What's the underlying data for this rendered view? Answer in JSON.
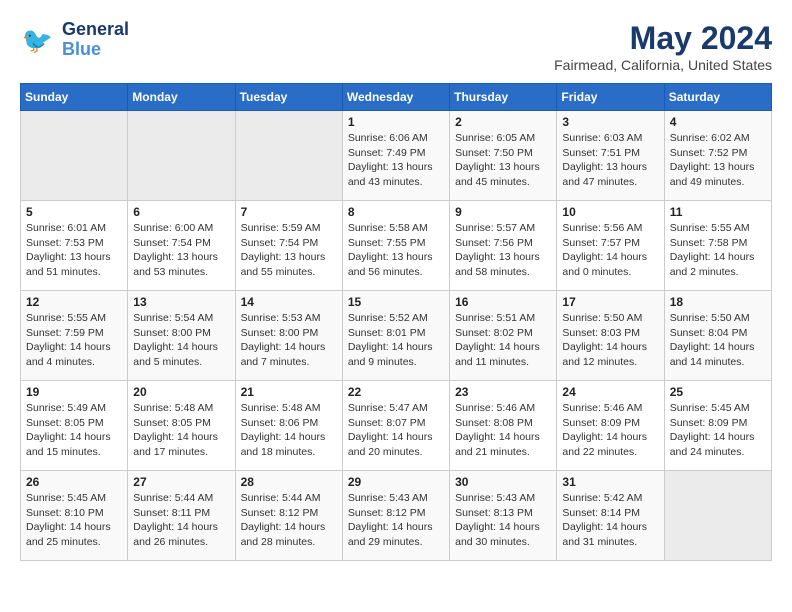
{
  "header": {
    "logo_line1": "General",
    "logo_line2": "Blue",
    "month_year": "May 2024",
    "location": "Fairmead, California, United States"
  },
  "days_of_week": [
    "Sunday",
    "Monday",
    "Tuesday",
    "Wednesday",
    "Thursday",
    "Friday",
    "Saturday"
  ],
  "weeks": [
    [
      {
        "day": "",
        "sunrise": "",
        "sunset": "",
        "daylight": "",
        "empty": true
      },
      {
        "day": "",
        "sunrise": "",
        "sunset": "",
        "daylight": "",
        "empty": true
      },
      {
        "day": "",
        "sunrise": "",
        "sunset": "",
        "daylight": "",
        "empty": true
      },
      {
        "day": "1",
        "sunrise": "Sunrise: 6:06 AM",
        "sunset": "Sunset: 7:49 PM",
        "daylight": "Daylight: 13 hours and 43 minutes."
      },
      {
        "day": "2",
        "sunrise": "Sunrise: 6:05 AM",
        "sunset": "Sunset: 7:50 PM",
        "daylight": "Daylight: 13 hours and 45 minutes."
      },
      {
        "day": "3",
        "sunrise": "Sunrise: 6:03 AM",
        "sunset": "Sunset: 7:51 PM",
        "daylight": "Daylight: 13 hours and 47 minutes."
      },
      {
        "day": "4",
        "sunrise": "Sunrise: 6:02 AM",
        "sunset": "Sunset: 7:52 PM",
        "daylight": "Daylight: 13 hours and 49 minutes."
      }
    ],
    [
      {
        "day": "5",
        "sunrise": "Sunrise: 6:01 AM",
        "sunset": "Sunset: 7:53 PM",
        "daylight": "Daylight: 13 hours and 51 minutes."
      },
      {
        "day": "6",
        "sunrise": "Sunrise: 6:00 AM",
        "sunset": "Sunset: 7:54 PM",
        "daylight": "Daylight: 13 hours and 53 minutes."
      },
      {
        "day": "7",
        "sunrise": "Sunrise: 5:59 AM",
        "sunset": "Sunset: 7:54 PM",
        "daylight": "Daylight: 13 hours and 55 minutes."
      },
      {
        "day": "8",
        "sunrise": "Sunrise: 5:58 AM",
        "sunset": "Sunset: 7:55 PM",
        "daylight": "Daylight: 13 hours and 56 minutes."
      },
      {
        "day": "9",
        "sunrise": "Sunrise: 5:57 AM",
        "sunset": "Sunset: 7:56 PM",
        "daylight": "Daylight: 13 hours and 58 minutes."
      },
      {
        "day": "10",
        "sunrise": "Sunrise: 5:56 AM",
        "sunset": "Sunset: 7:57 PM",
        "daylight": "Daylight: 14 hours and 0 minutes."
      },
      {
        "day": "11",
        "sunrise": "Sunrise: 5:55 AM",
        "sunset": "Sunset: 7:58 PM",
        "daylight": "Daylight: 14 hours and 2 minutes."
      }
    ],
    [
      {
        "day": "12",
        "sunrise": "Sunrise: 5:55 AM",
        "sunset": "Sunset: 7:59 PM",
        "daylight": "Daylight: 14 hours and 4 minutes."
      },
      {
        "day": "13",
        "sunrise": "Sunrise: 5:54 AM",
        "sunset": "Sunset: 8:00 PM",
        "daylight": "Daylight: 14 hours and 5 minutes."
      },
      {
        "day": "14",
        "sunrise": "Sunrise: 5:53 AM",
        "sunset": "Sunset: 8:00 PM",
        "daylight": "Daylight: 14 hours and 7 minutes."
      },
      {
        "day": "15",
        "sunrise": "Sunrise: 5:52 AM",
        "sunset": "Sunset: 8:01 PM",
        "daylight": "Daylight: 14 hours and 9 minutes."
      },
      {
        "day": "16",
        "sunrise": "Sunrise: 5:51 AM",
        "sunset": "Sunset: 8:02 PM",
        "daylight": "Daylight: 14 hours and 11 minutes."
      },
      {
        "day": "17",
        "sunrise": "Sunrise: 5:50 AM",
        "sunset": "Sunset: 8:03 PM",
        "daylight": "Daylight: 14 hours and 12 minutes."
      },
      {
        "day": "18",
        "sunrise": "Sunrise: 5:50 AM",
        "sunset": "Sunset: 8:04 PM",
        "daylight": "Daylight: 14 hours and 14 minutes."
      }
    ],
    [
      {
        "day": "19",
        "sunrise": "Sunrise: 5:49 AM",
        "sunset": "Sunset: 8:05 PM",
        "daylight": "Daylight: 14 hours and 15 minutes."
      },
      {
        "day": "20",
        "sunrise": "Sunrise: 5:48 AM",
        "sunset": "Sunset: 8:05 PM",
        "daylight": "Daylight: 14 hours and 17 minutes."
      },
      {
        "day": "21",
        "sunrise": "Sunrise: 5:48 AM",
        "sunset": "Sunset: 8:06 PM",
        "daylight": "Daylight: 14 hours and 18 minutes."
      },
      {
        "day": "22",
        "sunrise": "Sunrise: 5:47 AM",
        "sunset": "Sunset: 8:07 PM",
        "daylight": "Daylight: 14 hours and 20 minutes."
      },
      {
        "day": "23",
        "sunrise": "Sunrise: 5:46 AM",
        "sunset": "Sunset: 8:08 PM",
        "daylight": "Daylight: 14 hours and 21 minutes."
      },
      {
        "day": "24",
        "sunrise": "Sunrise: 5:46 AM",
        "sunset": "Sunset: 8:09 PM",
        "daylight": "Daylight: 14 hours and 22 minutes."
      },
      {
        "day": "25",
        "sunrise": "Sunrise: 5:45 AM",
        "sunset": "Sunset: 8:09 PM",
        "daylight": "Daylight: 14 hours and 24 minutes."
      }
    ],
    [
      {
        "day": "26",
        "sunrise": "Sunrise: 5:45 AM",
        "sunset": "Sunset: 8:10 PM",
        "daylight": "Daylight: 14 hours and 25 minutes."
      },
      {
        "day": "27",
        "sunrise": "Sunrise: 5:44 AM",
        "sunset": "Sunset: 8:11 PM",
        "daylight": "Daylight: 14 hours and 26 minutes."
      },
      {
        "day": "28",
        "sunrise": "Sunrise: 5:44 AM",
        "sunset": "Sunset: 8:12 PM",
        "daylight": "Daylight: 14 hours and 28 minutes."
      },
      {
        "day": "29",
        "sunrise": "Sunrise: 5:43 AM",
        "sunset": "Sunset: 8:12 PM",
        "daylight": "Daylight: 14 hours and 29 minutes."
      },
      {
        "day": "30",
        "sunrise": "Sunrise: 5:43 AM",
        "sunset": "Sunset: 8:13 PM",
        "daylight": "Daylight: 14 hours and 30 minutes."
      },
      {
        "day": "31",
        "sunrise": "Sunrise: 5:42 AM",
        "sunset": "Sunset: 8:14 PM",
        "daylight": "Daylight: 14 hours and 31 minutes."
      },
      {
        "day": "",
        "sunrise": "",
        "sunset": "",
        "daylight": "",
        "empty": true
      }
    ]
  ]
}
